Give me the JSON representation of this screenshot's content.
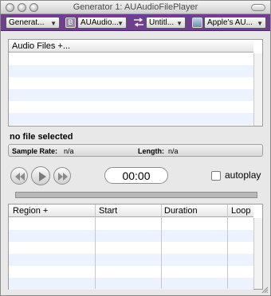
{
  "window": {
    "title": "Generator 1: AUAudioFilePlayer"
  },
  "toolbar": {
    "generator_popup": "Generat...",
    "au_popup": "AUAudio...",
    "preset_popup": "Untitl...",
    "manufacturer_popup": "Apple's AU...",
    "au_badge": "B"
  },
  "files_table": {
    "header": "Audio Files +..."
  },
  "file_status": "no file selected",
  "info": {
    "sample_rate_label": "Sample Rate:",
    "sample_rate_value": "n/a",
    "length_label": "Length:",
    "length_value": "n/a"
  },
  "transport": {
    "time": "00:00",
    "autoplay_label": "autoplay",
    "autoplay_checked": false
  },
  "regions_table": {
    "columns": [
      "Region +",
      "Start",
      "Duration",
      "Loop"
    ]
  },
  "colors": {
    "toolbar": "#6e3f8c",
    "row_alt": "#edf3fe"
  }
}
